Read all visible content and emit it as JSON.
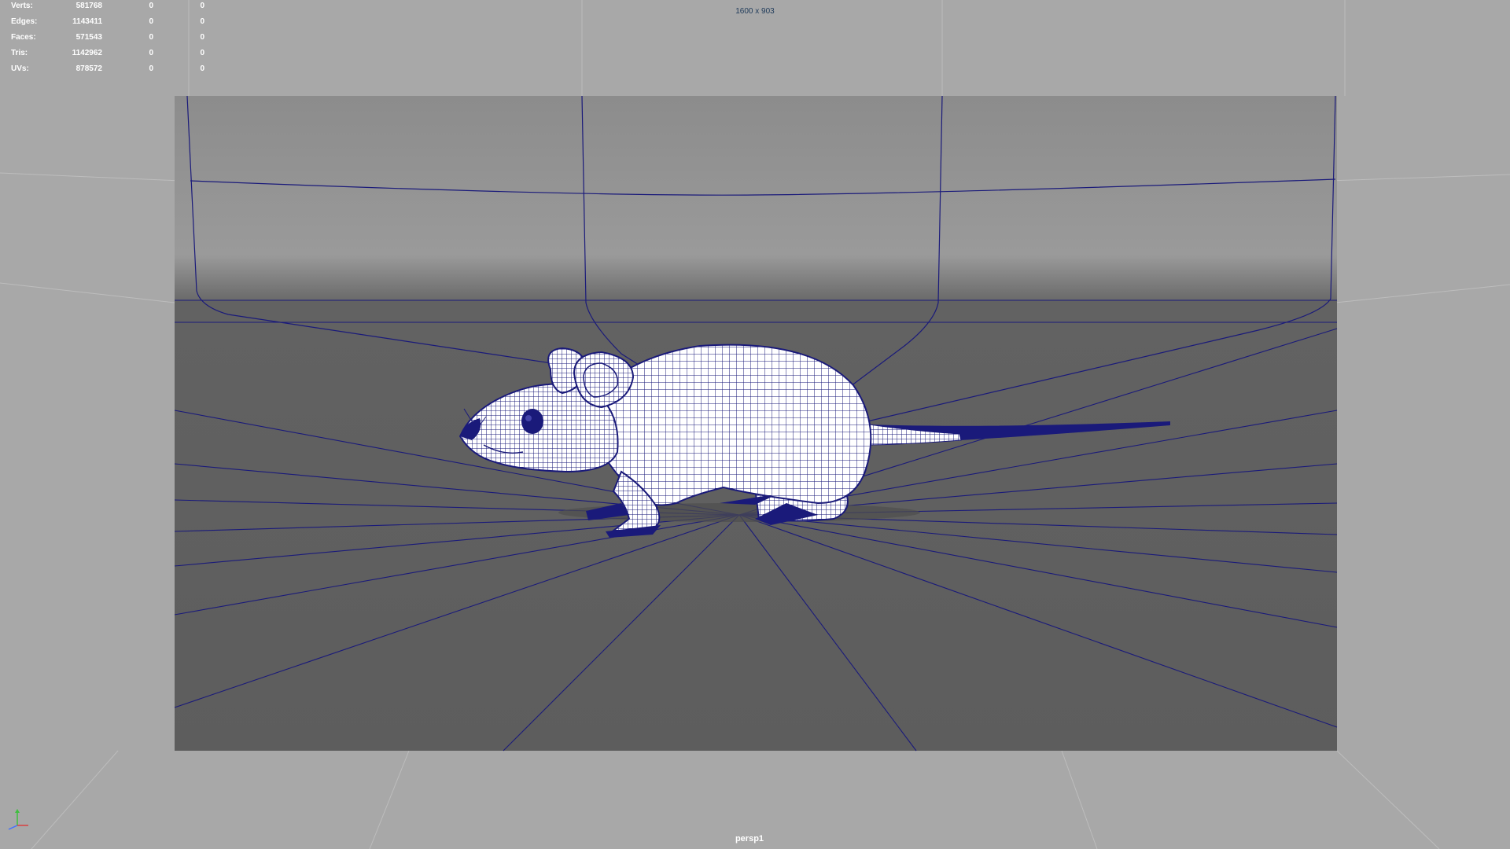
{
  "hud": {
    "stats": [
      {
        "label": "Verts:",
        "total": "581768",
        "selected": "0",
        "selected_2": "0"
      },
      {
        "label": "Edges:",
        "total": "1143411",
        "selected": "0",
        "selected_2": "0"
      },
      {
        "label": "Faces:",
        "total": "571543",
        "selected": "0",
        "selected_2": "0"
      },
      {
        "label": "Tris:",
        "total": "1142962",
        "selected": "0",
        "selected_2": "0"
      },
      {
        "label": "UVs:",
        "total": "878572",
        "selected": "0",
        "selected_2": "0"
      }
    ]
  },
  "viewport": {
    "resolution_gate": "1600 x 903",
    "camera": "persp1",
    "wire_color": "#1a1a7a",
    "backdrop_color": "#5e5e5e",
    "background_color": "#a8a8a8",
    "model_fill_color": "#ffffff"
  },
  "axis_indicator": {
    "icon": "axis-gizmo-icon",
    "x_color": "#d94040",
    "y_color": "#3fbf3f",
    "z_color": "#4070ff"
  }
}
